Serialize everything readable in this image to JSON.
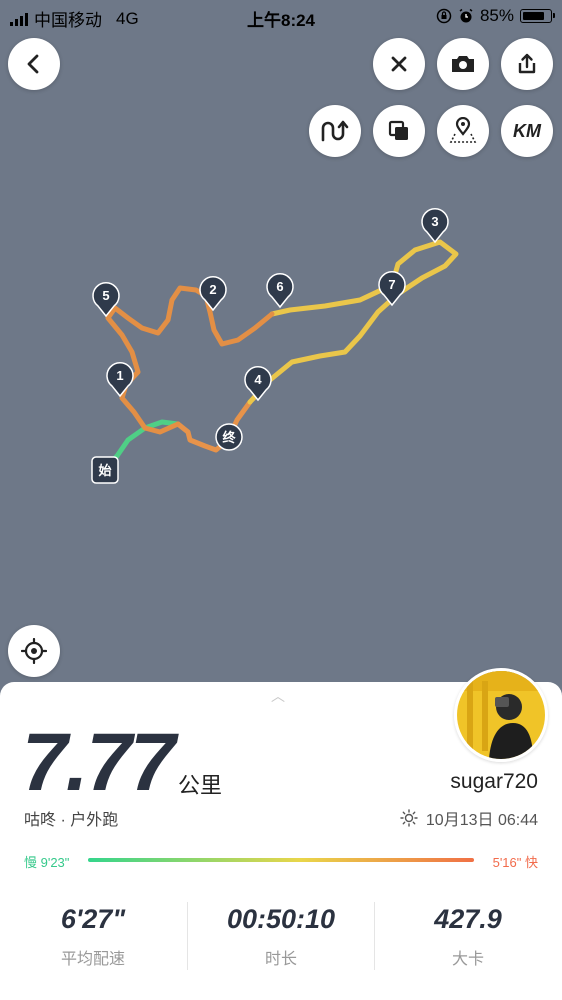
{
  "status_bar": {
    "carrier": "中国移动",
    "network": "4G",
    "time": "上午8:24",
    "battery": "85%",
    "battery_level": 0.85
  },
  "toolbar": {
    "back_icon": "chevron-left-icon",
    "close_icon": "close-icon",
    "camera_icon": "camera-icon",
    "share_icon": "share-icon",
    "route_icon": "route-icon",
    "layers_icon": "layers-icon",
    "location_icon": "map-pin-icon",
    "km_label": "KM",
    "locate_icon": "crosshair-icon"
  },
  "map": {
    "start_label": "始",
    "end_label": "终",
    "km_markers": [
      "1",
      "2",
      "3",
      "4",
      "5",
      "6",
      "7"
    ]
  },
  "summary": {
    "distance": "7.77",
    "distance_unit": "公里",
    "sport_type": "咕咚 · 户外跑",
    "username": "sugar720",
    "datetime": "10月13日 06:44",
    "pace_slow": "慢 9'23\"",
    "pace_fast": "5'16\" 快",
    "avg_pace": "6'27\"",
    "avg_pace_label": "平均配速",
    "duration": "00:50:10",
    "duration_label": "时长",
    "calories": "427.9",
    "calories_label": "大卡"
  },
  "colors": {
    "map_bg": "#6e7888",
    "marker": "#2f3a4b",
    "pace_slow": "#36c98b",
    "pace_fast": "#f26b4b"
  }
}
